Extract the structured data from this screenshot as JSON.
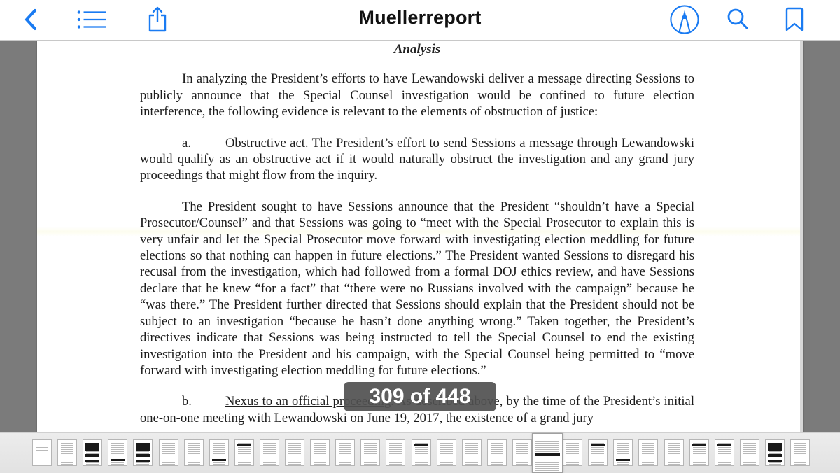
{
  "app": {
    "title": "Muellerreport",
    "accent_color": "#1a7bf2"
  },
  "navbar": {
    "left_buttons": [
      {
        "name": "back-button",
        "icon": "chevron-left-icon"
      },
      {
        "name": "table-of-contents-button",
        "icon": "list-icon"
      },
      {
        "name": "share-button",
        "icon": "share-icon"
      }
    ],
    "right_buttons": [
      {
        "name": "markup-button",
        "icon": "markup-pen-icon"
      },
      {
        "name": "search-button",
        "icon": "search-icon"
      },
      {
        "name": "bookmark-button",
        "icon": "bookmark-icon"
      }
    ]
  },
  "document": {
    "heading": "Analysis",
    "intro": "In analyzing the President’s efforts to have Lewandowski deliver a message directing Sessions to publicly announce that the Special Counsel investigation would be confined to future election interference, the following evidence is relevant to the elements of obstruction of justice:",
    "item_a": {
      "label": "a.",
      "title": "Obstructive act",
      "text": ". The President’s effort to send Sessions a message through Lewandowski would qualify as an obstructive act if it would naturally obstruct the investigation and any grand jury proceedings that might flow from the inquiry."
    },
    "body_paragraph": "The President sought to have Sessions announce that the President “shouldn’t have a Special Prosecutor/Counsel” and that Sessions was going to “meet with the Special Prosecutor to explain this is very unfair and let the Special Prosecutor move forward with investigating election meddling for future elections so that nothing can happen in future elections.” The President wanted Sessions to disregard his recusal from the investigation, which had followed from a formal DOJ ethics review, and have Sessions declare that he knew “for a fact” that “there were no Russians involved with the campaign” because he “was there.” The President further directed that Sessions should explain that the President should not be subject to an investigation “because he hasn’t done anything wrong.” Taken together, the President’s directives indicate that Sessions was being instructed to tell the Special Counsel to end the existing investigation into the President and his campaign, with the Special Counsel being permitted to “move forward with investigating election meddling for future elections.”",
    "item_b": {
      "label": "b.",
      "title": "Nexus to an official proceeding",
      "text": ". As described above, by the time of the President’s initial one-on-one meeting with Lewandowski on June 19, 2017, the existence of a grand jury"
    }
  },
  "page_indicator": {
    "current_page": 309,
    "total_pages": 448,
    "label": "309 of 448"
  },
  "thumbnails": {
    "count": 31,
    "current_index": 20,
    "pages": [
      {
        "style": "title"
      },
      {
        "style": "text"
      },
      {
        "style": "redacted-heavy"
      },
      {
        "style": "text-redact-bottom"
      },
      {
        "style": "redacted-heavy"
      },
      {
        "style": "text"
      },
      {
        "style": "text"
      },
      {
        "style": "text-redact-bottom"
      },
      {
        "style": "text-redact-top"
      },
      {
        "style": "text"
      },
      {
        "style": "text"
      },
      {
        "style": "text"
      },
      {
        "style": "text"
      },
      {
        "style": "text"
      },
      {
        "style": "text"
      },
      {
        "style": "text-redact-top"
      },
      {
        "style": "text"
      },
      {
        "style": "text"
      },
      {
        "style": "text"
      },
      {
        "style": "text"
      },
      {
        "style": "current"
      },
      {
        "style": "text"
      },
      {
        "style": "text-redact-top"
      },
      {
        "style": "text-redact-bottom"
      },
      {
        "style": "text"
      },
      {
        "style": "text"
      },
      {
        "style": "text-redact-top"
      },
      {
        "style": "text-redact-top"
      },
      {
        "style": "text"
      },
      {
        "style": "redacted-heavy"
      },
      {
        "style": "text"
      }
    ]
  }
}
